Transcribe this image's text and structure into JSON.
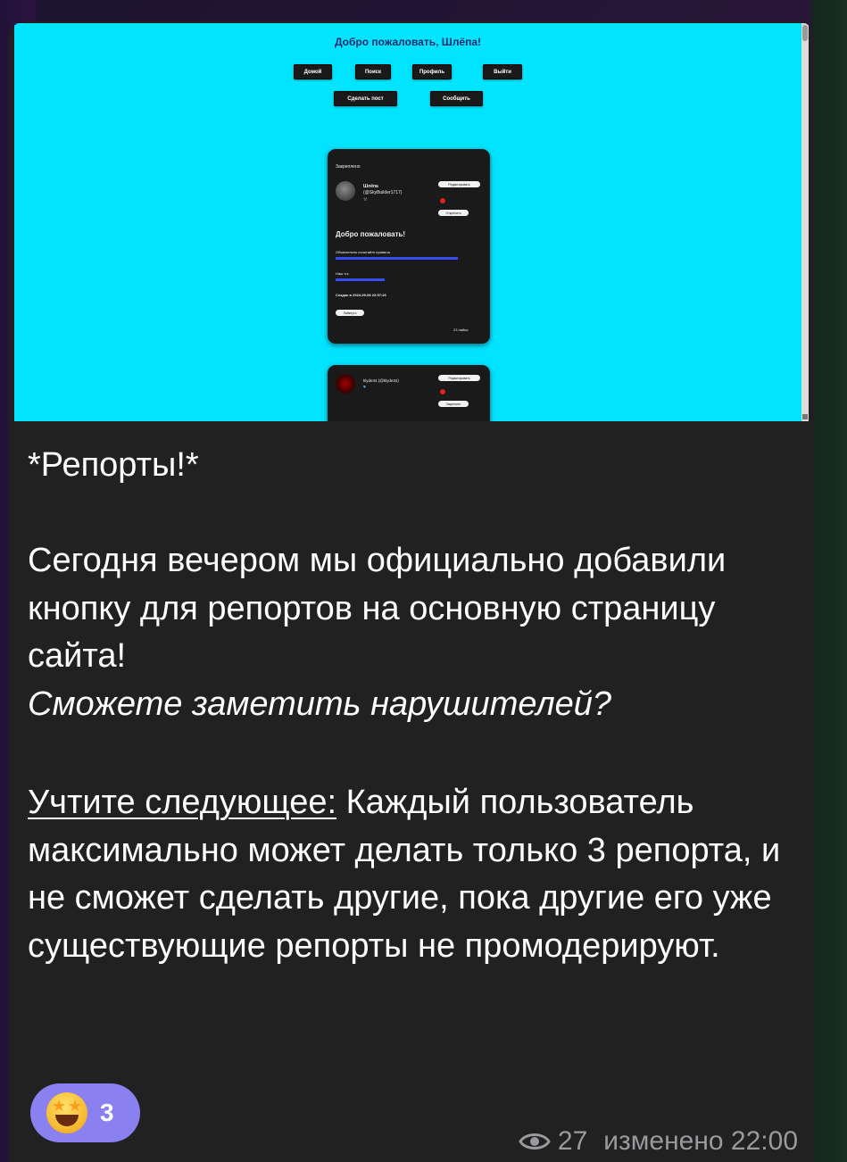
{
  "screenshot": {
    "welcome": "Добро пожаловать, Шлёпа!",
    "nav": [
      "Домой",
      "Поиск",
      "Профиль",
      "Выйти"
    ],
    "actions": [
      "Сделать пост",
      "Сообщить"
    ],
    "pinned_post": {
      "pinned_label": "Закреплено",
      "author_name": "Шлёпа",
      "author_handle": "(@SkyBuilder1717)",
      "edit_label": "Редактировать",
      "unpin_label": "Открепить",
      "title": "Добро пожаловать!",
      "rules_line": "Обязательно почитайте правила",
      "tg_label": "Наш тгк",
      "created": "Создан в 2024-09-08 22:57:26",
      "like_label": "Лайкнуть",
      "likes": "23 лайка"
    },
    "second_post": {
      "author": "klyde34 (@klyde34)",
      "edit_label": "Редактировать",
      "pin_label": "Закрепить"
    }
  },
  "message": {
    "heading": "*Репорты!*",
    "para1": "Сегодня вечером мы официально добавили кнопку для репортов на основную страницу сайта!",
    "para1_italic": "Сможете заметить нарушителей?",
    "note_label": "Учтите следующее:",
    "note_text": " Каждый пользователь максимально может делать только 3 репорта, и не сможет сделать другие, пока другие его уже существующие репорты не промодерируют."
  },
  "reaction": {
    "emoji": "star-struck-emoji",
    "count": "3"
  },
  "footer": {
    "views": "27",
    "edited": "изменено 22:00"
  }
}
